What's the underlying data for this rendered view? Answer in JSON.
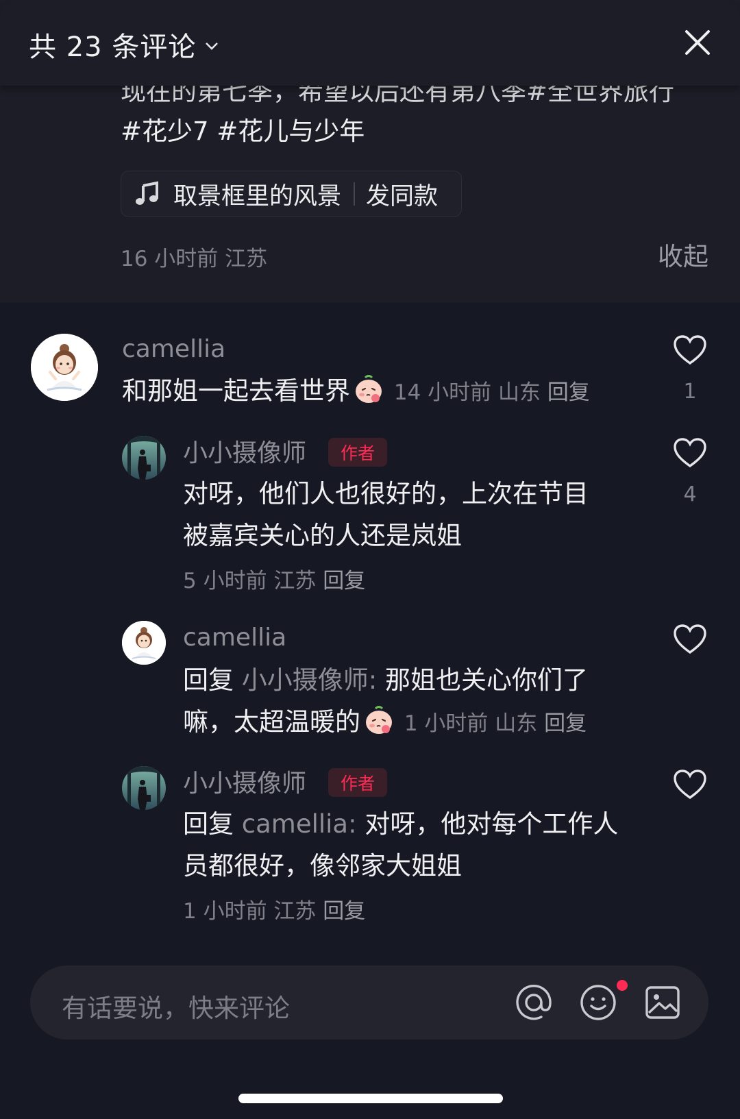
{
  "header": {
    "title": "共 23 条评论",
    "close_icon": "close-icon",
    "chevron_icon": "chevron-down-icon"
  },
  "post": {
    "desc_cut": "现在的第七季，希望以后还有第八季#全世界旅行",
    "tags": "#花少7 #花儿与少年",
    "music_title": "取景框里的风景",
    "music_action": "发同款",
    "meta": "16 小时前  江苏",
    "collapse": "收起"
  },
  "comments": [
    {
      "user": "camellia",
      "text": "和那姐一起去看世界",
      "meta": "14 小时前  山东",
      "reply": "回复",
      "likes": "1"
    },
    {
      "user": "小小摄像师",
      "badge": "作者",
      "line1": "对呀，他们人也很好的，上次在节目",
      "line2": "被嘉宾关心的人还是岚姐",
      "meta": "5 小时前  江苏",
      "reply": "回复",
      "likes": "4"
    },
    {
      "user": "camellia",
      "reply_prefix": "回复",
      "reply_to": "小小摄像师:",
      "line1": "那姐也关心你们了",
      "line2": "嘛，太超温暖的",
      "meta": "1 小时前  山东",
      "reply": "回复"
    },
    {
      "user": "小小摄像师",
      "badge": "作者",
      "reply_prefix": "回复",
      "reply_to": "camellia:",
      "line1": "对呀，他对每个工作人",
      "line2": "员都很好，像邻家大姐姐",
      "meta": "1 小时前  江苏",
      "reply": "回复"
    }
  ],
  "input": {
    "placeholder": "有话要说，快来评论",
    "icons": [
      "at-icon",
      "emoji-icon",
      "image-icon"
    ]
  },
  "colors": {
    "background": "#161823",
    "header_background": "#1c1d26",
    "accent": "#fe2c55",
    "muted_text": "#80818a"
  }
}
